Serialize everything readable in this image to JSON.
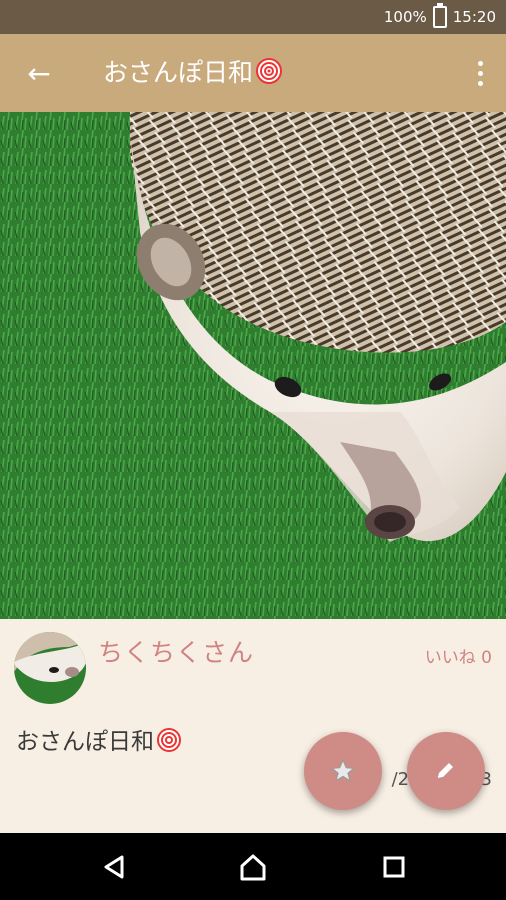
{
  "status_bar": {
    "battery": "100%",
    "time": "15:20"
  },
  "toolbar": {
    "title": "おさんぽ日和",
    "back_icon": "arrow-left-icon",
    "menu_icon": "more-vert-icon"
  },
  "post": {
    "username": "ちくちくさん",
    "likes_label": "いいね",
    "likes_count": "0",
    "text": "おさんぽ日和",
    "date_visible": "/29",
    "date_tail": "3",
    "image_subject": "hedgehog-photo"
  },
  "actions": {
    "favorite_icon": "star-icon",
    "edit_icon": "pencil-icon"
  },
  "nav": {
    "back_icon": "triangle-back-icon",
    "home_icon": "home-icon",
    "recent_icon": "square-recents-icon"
  },
  "colors": {
    "toolbar": "#c8aa7d",
    "status": "#6b5a45",
    "accent": "#d18383",
    "fab": "#cf8b86",
    "background": "#f8efe4"
  }
}
